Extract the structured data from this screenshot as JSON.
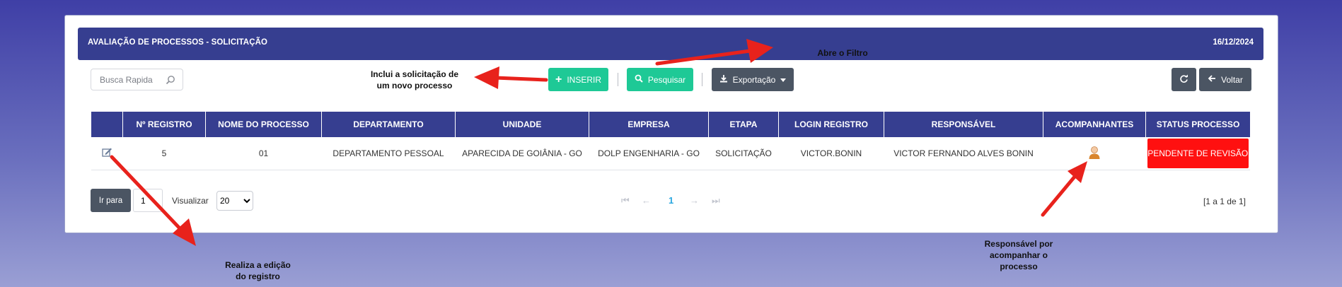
{
  "header": {
    "title": "AVALIAÇÃO DE PROCESSOS - SOLICITAÇÃO",
    "date": "16/12/2024"
  },
  "toolbar": {
    "search_placeholder": "Busca Rapida",
    "insert_label": "INSERIR",
    "search_label": "Pesquisar",
    "export_label": "Exportação",
    "back_label": "Voltar"
  },
  "table": {
    "columns": [
      "",
      "Nº REGISTRO",
      "NOME DO PROCESSO",
      "DEPARTAMENTO",
      "UNIDADE",
      "EMPRESA",
      "ETAPA",
      "LOGIN REGISTRO",
      "RESPONSÁVEL",
      "ACOMPANHANTES",
      "STATUS PROCESSO"
    ],
    "rows": [
      {
        "registro": "5",
        "nome": "01",
        "departamento": "DEPARTAMENTO PESSOAL",
        "unidade": "APARECIDA DE GOIÂNIA - GO",
        "empresa": "DOLP ENGENHARIA - GO",
        "etapa": "SOLICITAÇÃO",
        "login": "VICTOR.BONIN",
        "responsavel": "VICTOR FERNANDO ALVES BONIN",
        "status": "PENDENTE DE REVISÃO"
      }
    ]
  },
  "pager": {
    "goto_label": "Ir para",
    "goto_value": "1",
    "view_label": "Visualizar",
    "page_size": "20",
    "current_page": "1",
    "count_text": "[1 a 1 de 1]"
  },
  "annotations": {
    "insert_note": "Inclui a solicitação de um novo processo",
    "filter_note": "Abre o Filtro",
    "edit_note": "Realiza a edição do registro",
    "companion_note": "Responsável por acompanhar o processo"
  },
  "colors": {
    "header_bg": "#363e90",
    "accent_green": "#1ec996",
    "status_red": "#ff1010",
    "arrow_red": "#e8221c",
    "page_blue": "#2aa7e0"
  },
  "icons": {
    "search": "search-icon",
    "insert": "plus-icon",
    "filter": "magnifier-icon",
    "export": "download-icon",
    "refresh": "refresh-icon",
    "back": "arrow-left-icon",
    "edit": "edit-icon",
    "companion": "user-icon"
  }
}
